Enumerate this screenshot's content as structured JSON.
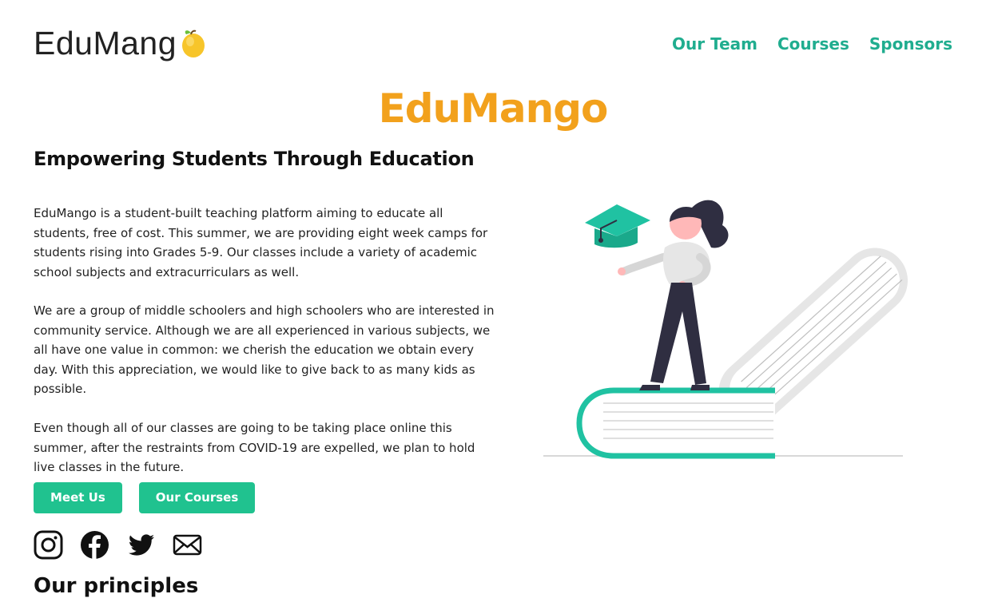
{
  "header": {
    "logo_text": "EduMang",
    "logo_icon": "mango-icon",
    "nav": [
      {
        "label": "Our Team"
      },
      {
        "label": "Courses"
      },
      {
        "label": "Sponsors"
      }
    ]
  },
  "hero": {
    "title": "EduMango",
    "subtitle": "Empowering Students Through Education",
    "paragraphs": [
      "EduMango is a student-built teaching platform aiming to educate all students, free of cost. This summer, we are providing eight week camps for students rising into Grades 5-9. Our classes include a variety of academic school subjects and extracurriculars as well.",
      "We are a group of middle schoolers and high schoolers who are interested in community service. Although we are all experienced in various subjects, we all have one value in common: we cherish the education we obtain every day. With this appreciation, we would like to give back to as many kids as possible.",
      "Even though all of our classes are going to be taking place online this summer, after the restraints from COVID-19 are expelled, we plan to hold live classes in the future."
    ],
    "buttons": [
      {
        "label": "Meet Us"
      },
      {
        "label": "Our Courses"
      }
    ],
    "socials": [
      "instagram-icon",
      "facebook-icon",
      "twitter-icon",
      "mail-icon"
    ],
    "illustration": "student-on-books-illustration"
  },
  "principles": {
    "heading": "Our principles"
  },
  "colors": {
    "accent_orange": "#f2a11c",
    "accent_teal": "#20ad8f",
    "button_green": "#20c28f",
    "text": "#111111"
  }
}
